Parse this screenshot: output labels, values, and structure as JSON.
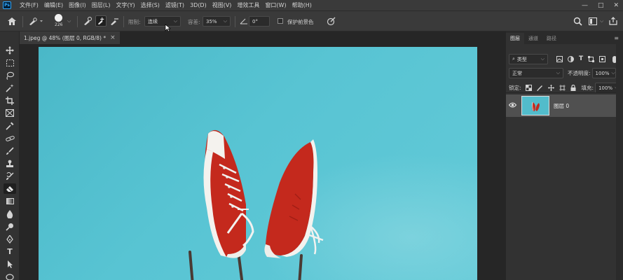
{
  "app": {
    "logo_text": "Ps"
  },
  "menu": [
    "文件(F)",
    "编辑(E)",
    "图像(I)",
    "图层(L)",
    "文字(Y)",
    "选择(S)",
    "滤镜(T)",
    "3D(D)",
    "视图(V)",
    "增效工具",
    "窗口(W)",
    "帮助(H)"
  ],
  "window_controls": {
    "minimize": "—",
    "maximize": "□",
    "close": "✕"
  },
  "options": {
    "brush_size": "226",
    "limit_label": "限制:",
    "limit_value": "连续",
    "tolerance_label": "容差:",
    "tolerance_value": "35%",
    "angle_value": "0°",
    "protect_fg_label": "保护前景色"
  },
  "document": {
    "tab_title": "1.jpeg @ 48% (图层 0, RGB/8) *",
    "close": "×"
  },
  "layers_panel": {
    "tabs": [
      "图层",
      "通道",
      "路径"
    ],
    "filter_label": "类型",
    "blend_mode": "正常",
    "opacity_label": "不透明度:",
    "opacity_value": "100%",
    "lock_label": "锁定:",
    "fill_label": "填充:",
    "fill_value": "100%",
    "layer_name": "图层 0"
  },
  "colors": {
    "accent": "#31a8ff",
    "sky": "#58c4d3",
    "shoe": "#c4291d"
  }
}
